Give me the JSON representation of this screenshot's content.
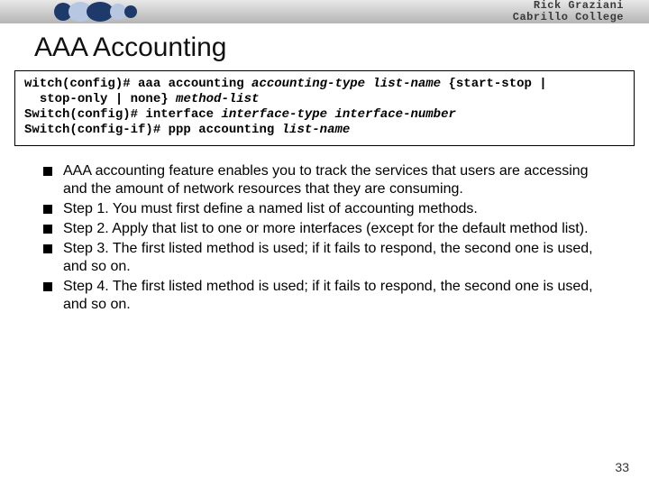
{
  "header": {
    "author_line1": "Rick Graziani",
    "author_line2": "Cabrillo College"
  },
  "title": "AAA Accounting",
  "code": {
    "line1_a": "witch(config)# aaa accounting ",
    "line1_b": "accounting-type list-name",
    "line1_c": " {start-stop |",
    "line2_a": "  stop-only | none} ",
    "line2_b": "method-list",
    "line3_a": "Switch(config)# interface ",
    "line3_b": "interface-type interface-number",
    "line4_a": "Switch(config-if)# ppp accounting ",
    "line4_b": "list-name"
  },
  "bullets": [
    "AAA accounting feature enables you to track the services that users are accessing and the amount of network resources that they are consuming.",
    "Step 1. You must first define a named list of accounting methods.",
    "Step 2. Apply that list to one or more interfaces (except for the default method list).",
    "Step 3. The first listed method is used; if it fails to respond, the second one is used, and so on.",
    "Step 4. The first listed method is used; if it fails to respond, the second one is used, and so on."
  ],
  "page_number": "33"
}
